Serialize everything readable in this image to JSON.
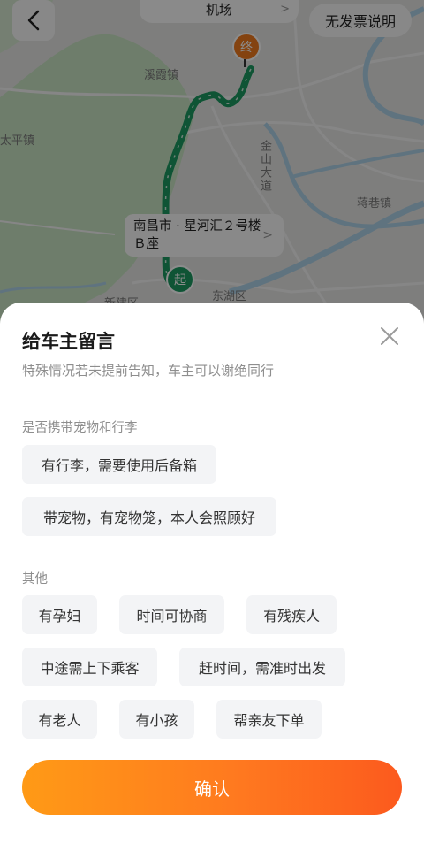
{
  "map": {
    "labels": {
      "xixia": "溪霞镇",
      "taiping": "太平镇",
      "jinshan": "金山大道",
      "jiangxiang": "蒋巷镇",
      "xinjian": "新建区",
      "donghu": "东湖区"
    },
    "destination_label": "机场",
    "origin_label": "南昌市 · 星河汇２号楼Ｂ座",
    "pin_end": "终",
    "pin_start": "起",
    "route_color": "#1d9a62"
  },
  "header": {
    "invoice_label": "无发票说明"
  },
  "sheet": {
    "title": "给车主留言",
    "subtitle": "特殊情况若未提前告知，车主可以谢绝同行",
    "section_pets": "是否携带宠物和行李",
    "pet_options": [
      "有行李，需要使用后备箱",
      "带宠物，有宠物笼，本人会照顾好"
    ],
    "section_other": "其他",
    "other_options": [
      "有孕妇",
      "时间可协商",
      "有残疾人",
      "中途需上下乘客",
      "赶时间，需准时出发",
      "有老人",
      "有小孩",
      "帮亲友下单"
    ],
    "confirm_label": "确认"
  },
  "colors": {
    "confirm_start": "#ff9a16",
    "confirm_end": "#fc5a1e"
  }
}
